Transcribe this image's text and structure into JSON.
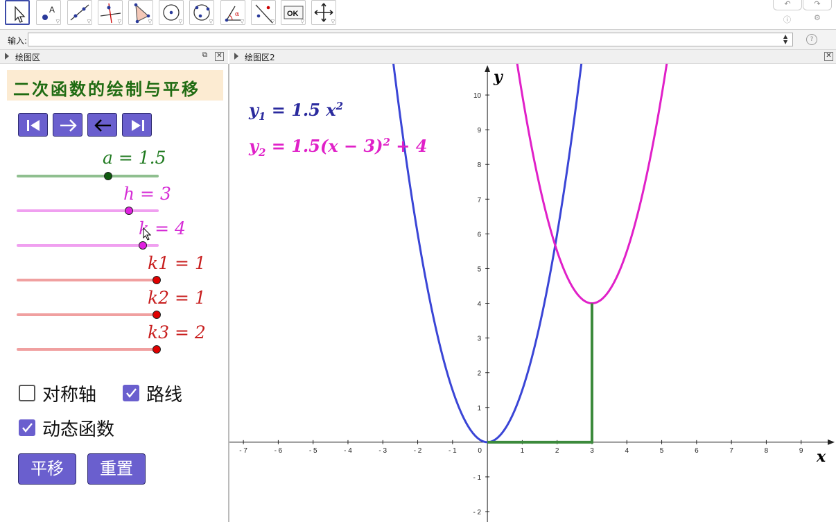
{
  "toolbar": {
    "tools": [
      {
        "name": "move-tool",
        "icon": "pointer-arrow-icon"
      },
      {
        "name": "point-tool",
        "icon": "point-icon"
      },
      {
        "name": "line-tool",
        "icon": "line-icon"
      },
      {
        "name": "perpendicular-tool",
        "icon": "perpendicular-line-icon"
      },
      {
        "name": "polygon-tool",
        "icon": "polygon-icon"
      },
      {
        "name": "circle-tool",
        "icon": "circle-icon"
      },
      {
        "name": "circle-three-points-tool",
        "icon": "circle-points-icon"
      },
      {
        "name": "angle-tool",
        "icon": "angle-icon"
      },
      {
        "name": "reflect-tool",
        "icon": "reflect-icon"
      },
      {
        "name": "slider-tool",
        "label": "OK"
      },
      {
        "name": "move-view-tool",
        "icon": "move-arrows-icon"
      }
    ],
    "undo_icon": "undo-icon",
    "redo_icon": "redo-icon",
    "help_icon": "help-icon",
    "settings_icon": "gear-icon"
  },
  "input_bar": {
    "label": "输入:",
    "value": "",
    "help_icon": "help-icon"
  },
  "left_panel": {
    "header": "绘图区",
    "title": "二次函数的绘制与平移",
    "nav_buttons": [
      "first-icon",
      "play-forward-icon",
      "back-arrow-icon",
      "last-icon"
    ],
    "sliders": [
      {
        "label": "a = 1.5",
        "value": 1.5,
        "color": "#1f7a1f",
        "track": "#8fbf8f",
        "knob": "#0f5a0f"
      },
      {
        "label": "h = 3",
        "value": 3,
        "color": "#d62ed6",
        "track": "#f0a0f0",
        "knob": "#e020e0"
      },
      {
        "label": "k = 4",
        "value": 4,
        "color": "#d62ed6",
        "track": "#f0a0f0",
        "knob": "#e020e0"
      },
      {
        "label": "k1 = 1",
        "value": 1,
        "color": "#c81e1e",
        "track": "#f0a0a0",
        "knob": "#e00000"
      },
      {
        "label": "k2 = 1",
        "value": 1,
        "color": "#c81e1e",
        "track": "#f0a0a0",
        "knob": "#e00000"
      },
      {
        "label": "k3 = 2",
        "value": 2,
        "color": "#c81e1e",
        "track": "#f0a0a0",
        "knob": "#e00000"
      }
    ],
    "checkboxes": [
      {
        "label": "对称轴",
        "checked": false
      },
      {
        "label": "路线",
        "checked": true
      },
      {
        "label": "动态函数",
        "checked": true
      }
    ],
    "buttons": {
      "translate": "平移",
      "reset": "重置"
    }
  },
  "graph_panel": {
    "header": "绘图区2",
    "equations": {
      "y1_lhs": "y",
      "y1_sub": "1",
      "y1_rhs": " = 1.5 x",
      "y1_sup": "2",
      "y2_lhs": "y",
      "y2_sub": "2",
      "y2_rhs": " = 1.5(x − 3)",
      "y2_sup": "2",
      "y2_tail": " + 4"
    },
    "x_axis_label": "x",
    "y_axis_label": "y",
    "x_ticks": [
      "-7",
      "-6",
      "-5",
      "-4",
      "-3",
      "-2",
      "-1",
      "0",
      "1",
      "2",
      "3",
      "4",
      "5",
      "6",
      "7",
      "8",
      "9"
    ],
    "y_ticks": [
      "-2",
      "-1",
      "1",
      "2",
      "3",
      "4",
      "5",
      "6",
      "7",
      "8",
      "9",
      "10"
    ],
    "colors": {
      "y1": "#3a45d6",
      "y2": "#e020c8",
      "path": "#3c8a3c"
    }
  },
  "chart_data": {
    "type": "line",
    "title": "",
    "xlabel": "x",
    "ylabel": "y",
    "xlim": [
      -7.4,
      10.0
    ],
    "ylim": [
      -2.3,
      10.9
    ],
    "series": [
      {
        "name": "y1 = 1.5 x²",
        "function": "1.5*x^2",
        "a": 1.5,
        "h": 0,
        "k": 0
      },
      {
        "name": "y2 = 1.5(x − 3)² + 4",
        "function": "1.5*(x-3)^2+4",
        "a": 1.5,
        "h": 3,
        "k": 4
      },
      {
        "name": "path",
        "points": [
          [
            0,
            0
          ],
          [
            3,
            0
          ],
          [
            3,
            4
          ]
        ]
      }
    ],
    "grid": false
  }
}
